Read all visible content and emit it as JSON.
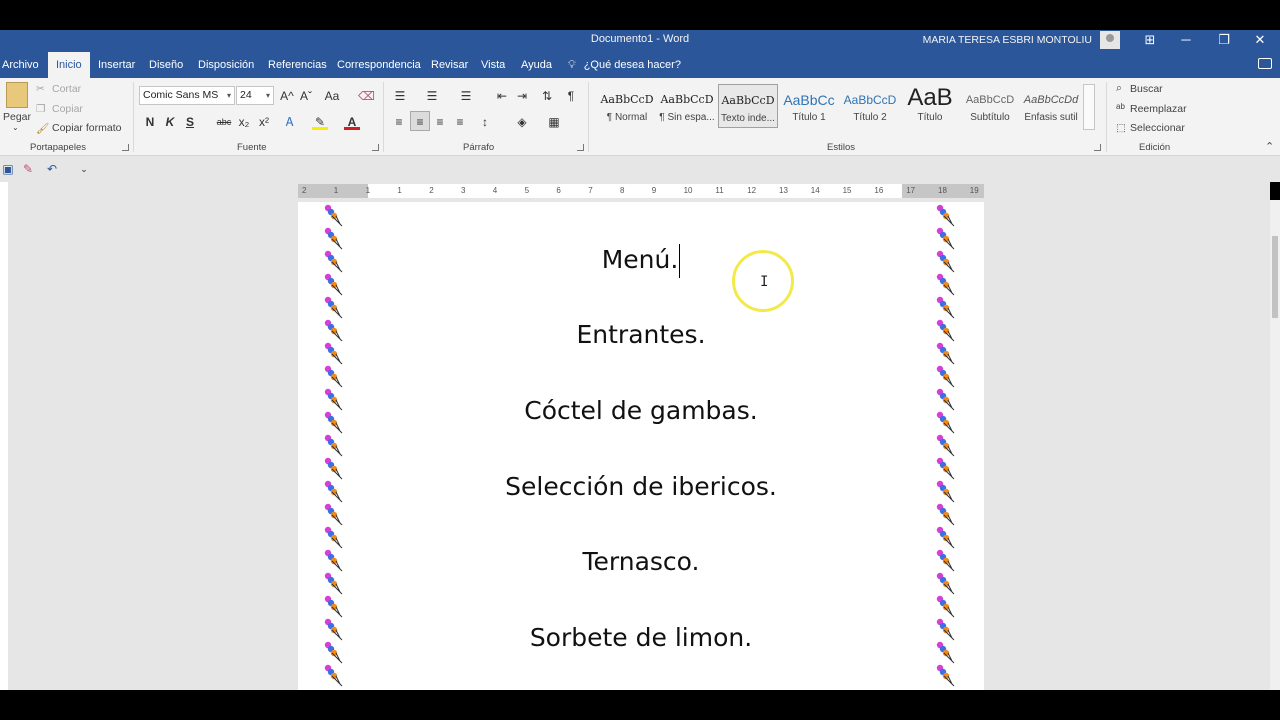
{
  "window": {
    "title": "Documento1  -  Word",
    "user": "MARIA TERESA ESBRI MONTOLIU",
    "controls": [
      "⊞",
      "─",
      "❐",
      "✕"
    ]
  },
  "tabs": [
    "Archivo",
    "Inicio",
    "Insertar",
    "Diseño",
    "Disposición",
    "Referencias",
    "Correspondencia",
    "Revisar",
    "Vista",
    "Ayuda"
  ],
  "tell_me": "¿Qué desea hacer?",
  "clipboard": {
    "paste": "Pegar",
    "cut": "Cortar",
    "copy": "Copiar",
    "format_painter": "Copiar formato",
    "group": "Portapapeles"
  },
  "font": {
    "name": "Comic Sans MS",
    "size": "24",
    "group": "Fuente",
    "bold": "N",
    "italic": "K",
    "underline": "S",
    "strike": "abc",
    "sub": "x₂",
    "sup": "x²",
    "grow": "A^",
    "shrink": "Aˇ",
    "case": "Aa",
    "color_letter": "A"
  },
  "paragraph": {
    "group": "Párrafo",
    "marks": "¶"
  },
  "styles": {
    "group": "Estilos",
    "items": [
      {
        "sample": "AaBbCcD",
        "name": "¶ Normal"
      },
      {
        "sample": "AaBbCcD",
        "name": "¶ Sin espa..."
      },
      {
        "sample": "AaBbCcD",
        "name": "Texto inde..."
      },
      {
        "sample": "AaBbCc",
        "name": "Título 1"
      },
      {
        "sample": "AaBbCcD",
        "name": "Título 2"
      },
      {
        "sample": "AaB",
        "name": "Título"
      },
      {
        "sample": "AaBbCcD",
        "name": "Subtítulo"
      },
      {
        "sample": "AaBbCcDd",
        "name": "Énfasis sutil"
      }
    ]
  },
  "editing": {
    "group": "Edición",
    "find": "Buscar",
    "replace": "Reemplazar",
    "select": "Seleccionar"
  },
  "ruler": {
    "labels": [
      "2",
      "1",
      "1",
      "1",
      "2",
      "3",
      "4",
      "5",
      "6",
      "7",
      "8",
      "9",
      "10",
      "11",
      "12",
      "13",
      "14",
      "15",
      "16",
      "17",
      "18",
      "19"
    ]
  },
  "document": {
    "lines": [
      "Menú.",
      "Entrantes.",
      "Cóctel de gambas.",
      "Selección de ibericos.",
      "Ternasco.",
      "Sorbete de limon."
    ]
  }
}
